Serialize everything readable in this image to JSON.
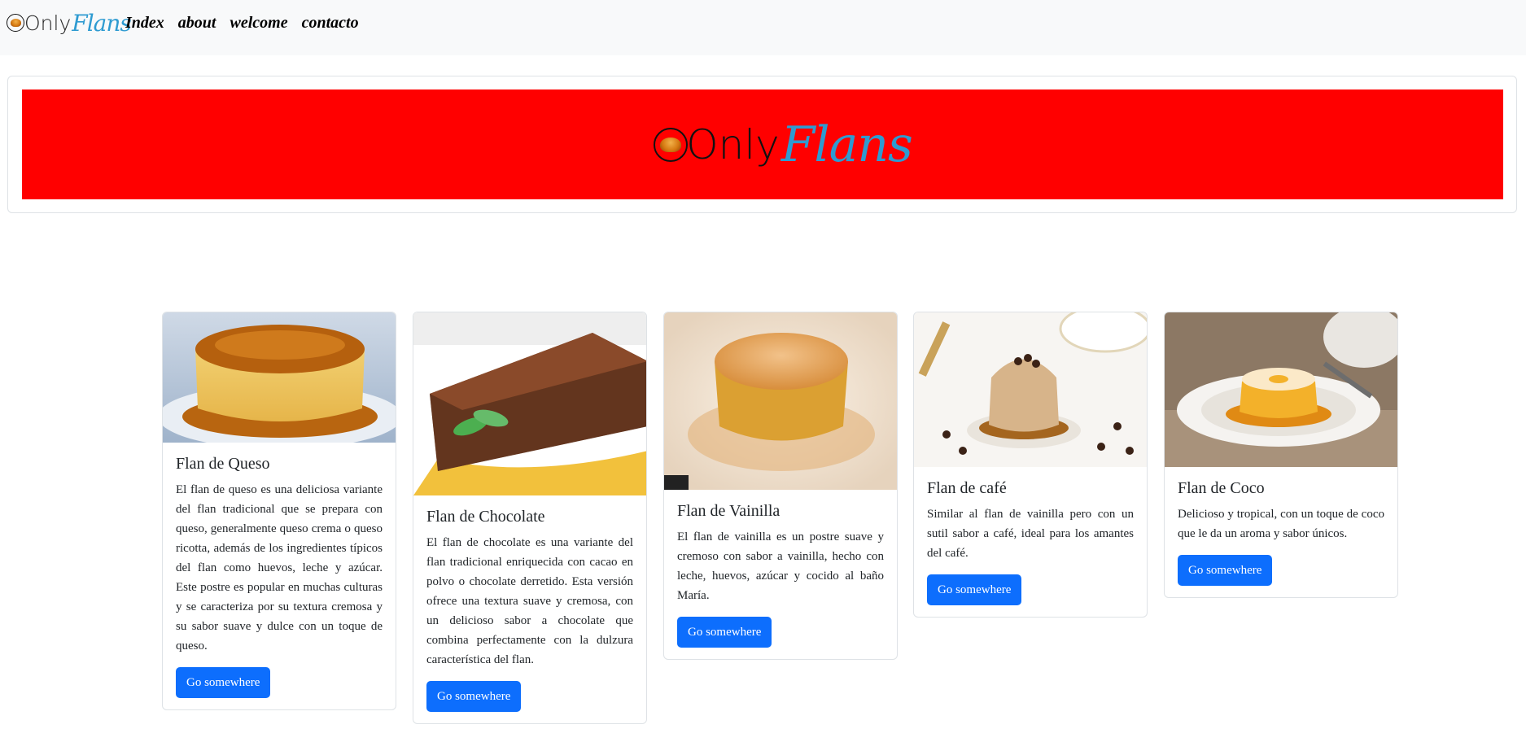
{
  "nav": {
    "logo": {
      "only": "Only",
      "flans": "Flans"
    },
    "links": [
      "Index",
      "about",
      "welcome",
      "contacto"
    ]
  },
  "banner": {
    "only": "Only",
    "flans": "Flans",
    "background": "#ff0000"
  },
  "colors": {
    "brand_blue": "#2e9bd1",
    "button": "#0d6efd",
    "navbar": "#f8f9fa"
  },
  "cards": [
    {
      "title": "Flan de Queso",
      "text": "El flan de queso es una deliciosa variante del flan tradicional que se prepara con queso, generalmente queso crema o queso ricotta, además de los ingredientes típicos del flan como huevos, leche y azúcar. Este postre es popular en muchas culturas y se caracteriza por su textura cremosa y su sabor suave y dulce con un toque de queso.",
      "button": "Go somewhere"
    },
    {
      "title": "Flan de Chocolate",
      "text": "El flan de chocolate es una variante del flan tradicional enriquecida con cacao en polvo o chocolate derretido. Esta versión ofrece una textura suave y cremosa, con un delicioso sabor a chocolate que combina perfectamente con la dulzura característica del flan.",
      "button": "Go somewhere"
    },
    {
      "title": "Flan de Vainilla",
      "text": "El flan de vainilla es un postre suave y cremoso con sabor a vainilla, hecho con leche, huevos, azúcar y cocido al baño María.",
      "button": "Go somewhere"
    },
    {
      "title": "Flan de café",
      "text": "Similar al flan de vainilla pero con un sutil sabor a café, ideal para los amantes del café.",
      "button": "Go somewhere"
    },
    {
      "title": "Flan de Coco",
      "text": "Delicioso y tropical, con un toque de coco que le da un aroma y sabor únicos.",
      "button": "Go somewhere"
    }
  ]
}
